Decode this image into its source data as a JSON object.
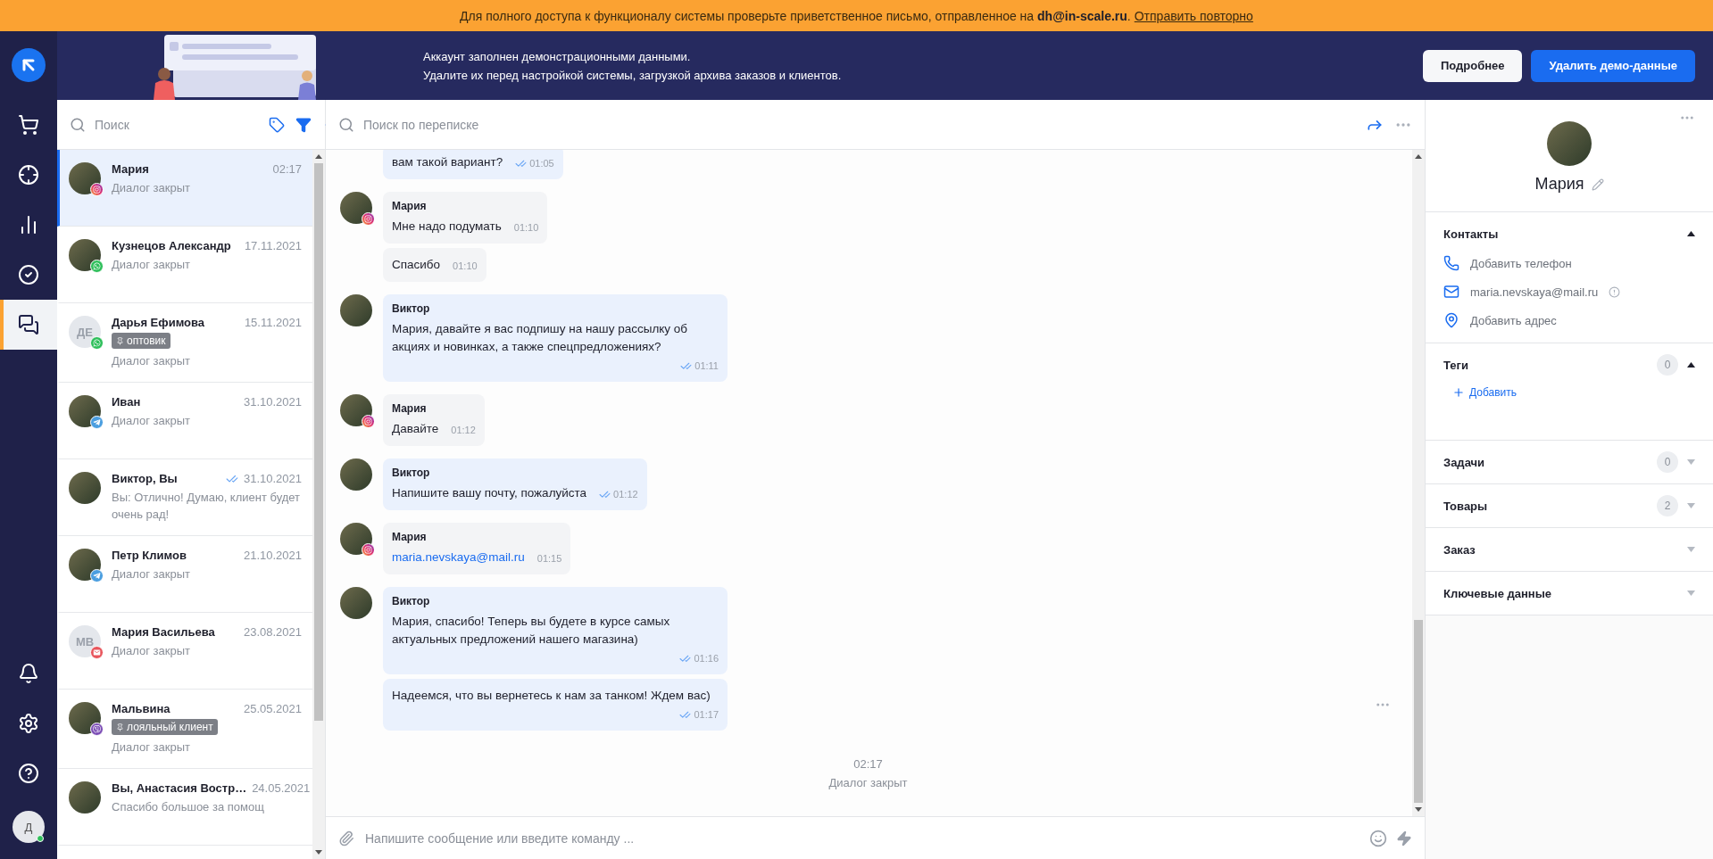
{
  "notice": {
    "text": "Для полного доступа к функционалу системы проверьте приветственное письмо, отправленное на **dh@in-scale.ru**.",
    "link": "Отправить повторно"
  },
  "banner": {
    "lines": [
      "Аккаунт заполнен демонстрационными данными.",
      "Удалите их перед настройкой системы, загрузкой архива заказов и клиентов."
    ],
    "buttons": [
      {
        "label": "Подробнее",
        "kind": "secondary"
      },
      {
        "label": "Удалить демо-данные",
        "kind": "primary"
      }
    ]
  },
  "nav": {
    "items": [
      {
        "kind": "cart",
        "selected": false
      },
      {
        "kind": "target",
        "selected": false
      },
      {
        "kind": "chart",
        "selected": false
      },
      {
        "kind": "check",
        "selected": false
      },
      {
        "kind": "chat",
        "selected": true
      }
    ],
    "bottom_items": [
      {
        "kind": "bell"
      },
      {
        "kind": "settings"
      },
      {
        "kind": "help"
      }
    ],
    "user": {
      "initials": "Д",
      "online": true
    }
  },
  "list": {
    "search": {
      "placeholder": "Поиск"
    },
    "conversations": [
      {
        "kind": "photo",
        "name": "Мария",
        "date": "02:17",
        "preview": "Диалог закрыт",
        "badge": {
          "kind": "instagram"
        },
        "selected": true
      },
      {
        "kind": "photo",
        "name": "Кузнецов Александр",
        "date": "17.11.2021",
        "preview": "Диалог закрыт",
        "badge": {
          "kind": "whatsapp"
        },
        "selected": false
      },
      {
        "kind": "initials",
        "name": "Дарья Ефимова",
        "date": "15.11.2021",
        "preview": "Диалог закрыт",
        "initials": "ДЕ",
        "badge": {
          "kind": "whatsapp"
        },
        "tag": "оптовик",
        "selected": false
      },
      {
        "kind": "photo",
        "name": "Иван",
        "date": "31.10.2021",
        "preview": "Диалог закрыт",
        "badge": {
          "kind": "telegram"
        },
        "selected": false
      },
      {
        "kind": "photo",
        "name": "Виктор, Вы",
        "date": "31.10.2021",
        "preview": "Вы: Отлично! Думаю, клиент будет очень рад!",
        "read": true,
        "selected": false
      },
      {
        "kind": "photo",
        "name": "Петр Климов",
        "date": "21.10.2021",
        "preview": "Диалог закрыт",
        "badge": {
          "kind": "telegram"
        },
        "selected": false
      },
      {
        "kind": "initials",
        "name": "Мария Васильева",
        "date": "23.08.2021",
        "preview": "Диалог закрыт",
        "initials": "МВ",
        "badge": {
          "kind": "form"
        },
        "selected": false
      },
      {
        "kind": "photo",
        "name": "Мальвина",
        "date": "25.05.2021",
        "preview": "Диалог закрыт",
        "badge": {
          "kind": "viber"
        },
        "tag": "лояльный клиент",
        "selected": false
      },
      {
        "kind": "photo",
        "name": "Вы, Анастасия Востр…",
        "date": "24.05.2021",
        "preview": "Спасибо большое за помощ",
        "selected": false
      }
    ]
  },
  "chat": {
    "search": {
      "placeholder": "Поиск по переписке"
    },
    "groups": [
      {
        "kind": "operator",
        "messages": [
          {
            "text": "вам такой вариант?",
            "time": "01:05",
            "read": true
          }
        ]
      },
      {
        "kind": "client",
        "author": "Мария",
        "badge": {
          "kind": "instagram"
        },
        "messages": [
          {
            "text": "Мне надо подумать",
            "time": "01:10"
          },
          {
            "text": "Спасибо",
            "time": "01:10"
          }
        ]
      },
      {
        "kind": "operator",
        "author": "Виктор",
        "messages": [
          {
            "text": "Мария, давайте я вас подпишу на нашу рассылку об акциях и новинках, а также спецпредложениях?",
            "time": "01:11",
            "read": true
          }
        ]
      },
      {
        "kind": "client",
        "author": "Мария",
        "badge": {
          "kind": "instagram"
        },
        "messages": [
          {
            "text": "Давайте",
            "time": "01:12"
          }
        ]
      },
      {
        "kind": "operator",
        "author": "Виктор",
        "messages": [
          {
            "text": "Напишите вашу почту, пожалуйста",
            "time": "01:12",
            "read": true
          }
        ]
      },
      {
        "kind": "client",
        "author": "Мария",
        "badge": {
          "kind": "instagram"
        },
        "messages": [
          {
            "text": "maria.nevskaya@mail.ru",
            "time": "01:15",
            "link": true
          }
        ]
      },
      {
        "kind": "operator",
        "author": "Виктор",
        "messages": [
          {
            "text": "Мария, спасибо! Теперь вы будете в курсе самых актуальных предложений нашего магазина)",
            "time": "01:16",
            "read": true
          },
          {
            "text": "Надеемся, что вы вернетесь к нам за танком! Ждем вас)",
            "time": "01:17",
            "read": true,
            "actions": true
          }
        ]
      }
    ],
    "footer": {
      "time": "02:17",
      "status": "Диалог закрыт"
    },
    "composer": {
      "placeholder": "Напишите сообщение или введите команду ..."
    }
  },
  "contact": {
    "name": "Мария",
    "sections": [
      {
        "kind": "contacts",
        "title": "Контакты",
        "expanded": true,
        "items": [
          {
            "kind": "phone",
            "text": "Добавить телефон"
          },
          {
            "kind": "email",
            "text": "maria.nevskaya@mail.ru",
            "warning": true
          },
          {
            "kind": "address",
            "text": "Добавить адрес"
          }
        ]
      },
      {
        "kind": "tags",
        "title": "Теги",
        "count": "0",
        "expanded": true,
        "action": "Добавить"
      },
      {
        "kind": "plain",
        "title": "Задачи",
        "count": "0",
        "expanded": false
      },
      {
        "kind": "plain",
        "title": "Товары",
        "count": "2",
        "expanded": false
      },
      {
        "kind": "plain",
        "title": "Заказ",
        "expanded": false
      },
      {
        "kind": "plain",
        "title": "Ключевые данные",
        "expanded": false
      }
    ]
  }
}
